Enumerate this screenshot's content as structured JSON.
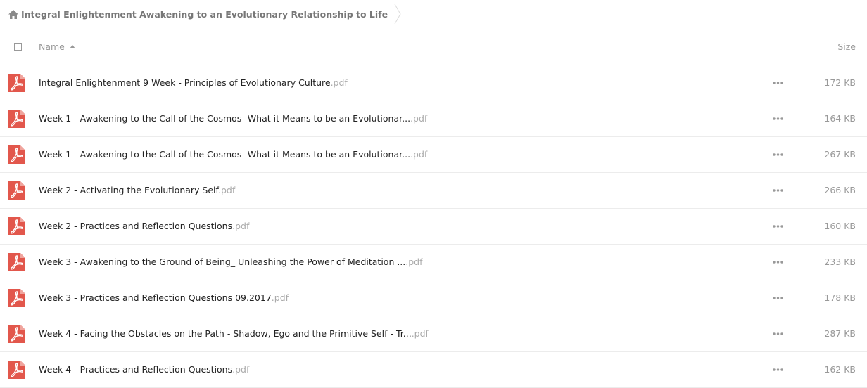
{
  "breadcrumb": {
    "title": "Integral Enlightenment Awakening to an Evolutionary Relationship to Life"
  },
  "header": {
    "name_label": "Name",
    "size_label": "Size"
  },
  "icons": {
    "home": "home-icon",
    "sort": "sort-ascending-icon",
    "file": "pdf-file-icon",
    "more": "more-options-icon"
  },
  "colors": {
    "pdf_red": "#e2574c",
    "text_muted": "#999999"
  },
  "files": [
    {
      "name": "Integral Enlightenment 9 Week - Principles of Evolutionary Culture",
      "ext": ".pdf",
      "size": "172 KB"
    },
    {
      "name": "Week 1 - Awakening to the Call of the Cosmos- What it Means to be an Evolutionar...",
      "ext": ".pdf",
      "size": "164 KB"
    },
    {
      "name": "Week 1 - Awakening to the Call of the Cosmos- What it Means to be an Evolutionar...",
      "ext": ".pdf",
      "size": "267 KB"
    },
    {
      "name": "Week 2 - Activating the Evolutionary Self",
      "ext": ".pdf",
      "size": "266 KB"
    },
    {
      "name": "Week 2 - Practices and Reflection Questions",
      "ext": ".pdf",
      "size": "160 KB"
    },
    {
      "name": "Week 3 - Awakening to the Ground of Being_ Unleashing the Power of Meditation ...",
      "ext": ".pdf",
      "size": "233 KB"
    },
    {
      "name": "Week 3 - Practices and Reflection Questions 09.2017",
      "ext": ".pdf",
      "size": "178 KB"
    },
    {
      "name": "Week 4 - Facing the Obstacles on the Path - Shadow, Ego and the Primitive Self - Tr...",
      "ext": ".pdf",
      "size": "287 KB"
    },
    {
      "name": "Week 4 - Practices and Reflection Questions",
      "ext": ".pdf",
      "size": "162 KB"
    }
  ]
}
